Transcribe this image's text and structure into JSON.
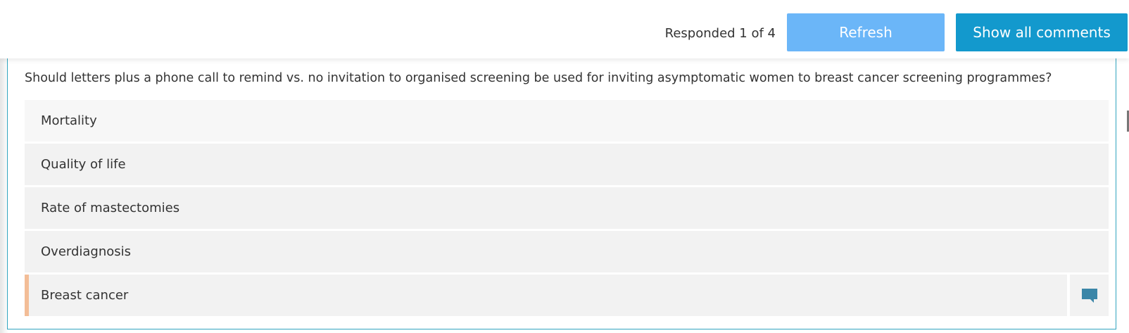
{
  "header": {
    "cut_text": "…ing…  …, y…  …  …ing…",
    "responded_label": "Responded 1 of 4",
    "refresh_label": "Refresh",
    "show_all_label": "Show all comments"
  },
  "question": {
    "cut_text": "…  …p…  …  …  …g…y…p…  …  …ing…p…g…",
    "text": "Should letters plus a phone call to remind vs. no invitation to organised screening be used for inviting asymptomatic women to breast cancer screening programmes?"
  },
  "outcomes": [
    {
      "label": "Mortality"
    },
    {
      "label": "Quality of life"
    },
    {
      "label": "Rate of mastectomies"
    },
    {
      "label": "Overdiagnosis"
    },
    {
      "label": "Breast cancer",
      "has_comment": true
    }
  ],
  "colors": {
    "refresh_button": "#6bb6f8",
    "show_all_button": "#1399cd",
    "panel_border": "#31a4bf",
    "marker": "#f3bd97",
    "comment_icon": "#3b86a8"
  },
  "icons": {
    "comment": "comment-icon"
  }
}
